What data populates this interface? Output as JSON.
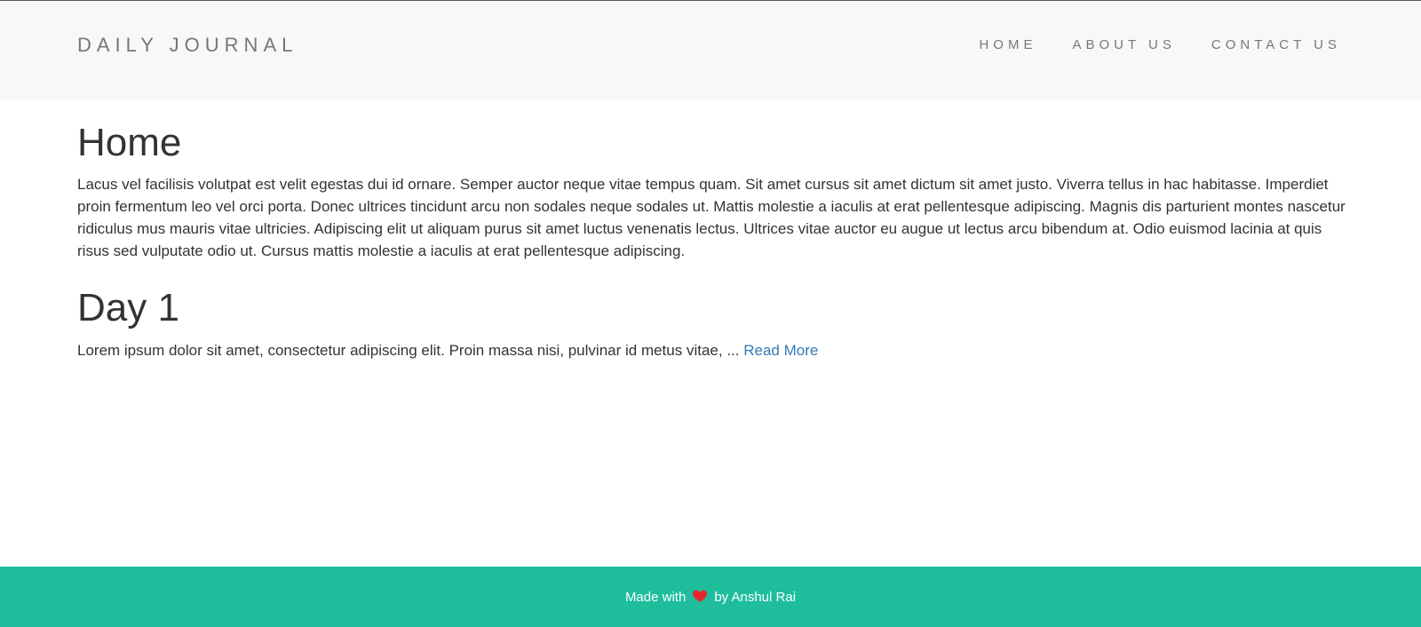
{
  "navbar": {
    "brand": "DAILY JOURNAL",
    "links": [
      "HOME",
      "ABOUT US",
      "CONTACT US"
    ]
  },
  "home": {
    "title": "Home",
    "body": "Lacus vel facilisis volutpat est velit egestas dui id ornare. Semper auctor neque vitae tempus quam. Sit amet cursus sit amet dictum sit amet justo. Viverra tellus in hac habitasse. Imperdiet proin fermentum leo vel orci porta. Donec ultrices tincidunt arcu non sodales neque sodales ut. Mattis molestie a iaculis at erat pellentesque adipiscing. Magnis dis parturient montes nascetur ridiculus mus mauris vitae ultricies. Adipiscing elit ut aliquam purus sit amet luctus venenatis lectus. Ultrices vitae auctor eu augue ut lectus arcu bibendum at. Odio euismod lacinia at quis risus sed vulputate odio ut. Cursus mattis molestie a iaculis at erat pellentesque adipiscing."
  },
  "posts": [
    {
      "title": "Day 1",
      "excerpt": "Lorem ipsum dolor sit amet, consectetur adipiscing elit. Proin massa nisi, pulvinar id metus vitae, ...",
      "link_label": "Read More"
    }
  ],
  "footer": {
    "prefix": "Made with",
    "icon": "heart-icon",
    "suffix": "by Anshul Rai"
  },
  "colors": {
    "navbar_bg": "#f8f8f8",
    "footer_bg": "#1ebe9c",
    "link": "#337ab7",
    "heart": "#e8262d"
  }
}
